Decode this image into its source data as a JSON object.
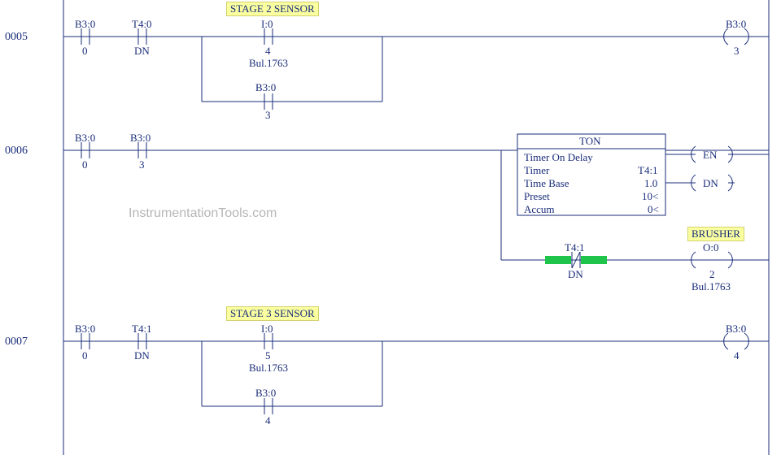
{
  "rungs": {
    "r5": "0005",
    "r6": "0006",
    "r7": "0007"
  },
  "labels": {
    "stage2": "STAGE 2 SENSOR",
    "stage3": "STAGE 3 SENSOR",
    "brusher": "BRUSHER"
  },
  "r5": {
    "c1_top": "B3:0",
    "c1_bot": "0",
    "c2_top": "T4:0",
    "c2_bot": "DN",
    "c3_top": "I:0",
    "c3_mid": "4",
    "c3_bot": "Bul.1763",
    "branch_top": "B3:0",
    "branch_bot": "3",
    "coil_top": "B3:0",
    "coil_bot": "3"
  },
  "r6": {
    "c1_top": "B3:0",
    "c1_bot": "0",
    "c2_top": "B3:0",
    "c2_bot": "3",
    "ton_title": "TON",
    "ton_l1": "Timer On Delay",
    "ton_l2a": "Timer",
    "ton_l2b": "T4:1",
    "ton_l3a": "Time Base",
    "ton_l3b": "1.0",
    "ton_l4a": "Preset",
    "ton_l4b": "10<",
    "ton_l5a": "Accum",
    "ton_l5b": "0<",
    "en": "EN",
    "dn": "DN",
    "nc_top": "T4:1",
    "nc_bot": "DN",
    "out_top": "O:0",
    "out_mid": "2",
    "out_bot": "Bul.1763"
  },
  "r7": {
    "c1_top": "B3:0",
    "c1_bot": "0",
    "c2_top": "T4:1",
    "c2_bot": "DN",
    "c3_top": "I:0",
    "c3_mid": "5",
    "c3_bot": "Bul.1763",
    "branch_top": "B3:0",
    "branch_bot": "4",
    "coil_top": "B3:0",
    "coil_bot": "4"
  },
  "watermark": "InstrumentationTools.com"
}
